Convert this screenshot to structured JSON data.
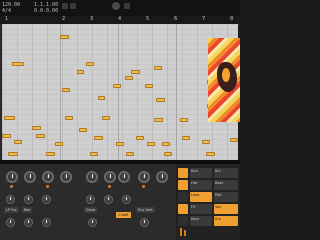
{
  "transport": {
    "tempo": "120.00",
    "signature": "4/4",
    "position": "1.1.1.00",
    "time": "0.0.0.00"
  },
  "ruler": {
    "bars": [
      "1",
      "2",
      "3",
      "4",
      "5",
      "6",
      "7",
      "8"
    ]
  },
  "devices": {
    "sections": [
      {
        "label": "LP Frq",
        "active": false
      },
      {
        "label": "Rez",
        "active": false
      },
      {
        "label": "Drive",
        "active": false
      },
      {
        "label": "Cutoff",
        "active": true
      },
      {
        "label": "Env Amt",
        "active": false
      }
    ]
  },
  "mixer": {
    "cells": [
      "Kick",
      "Snr",
      "Hat",
      "Bass",
      "Lead",
      "Pad",
      "FX",
      "Vox",
      "Keys",
      "Arp"
    ]
  }
}
